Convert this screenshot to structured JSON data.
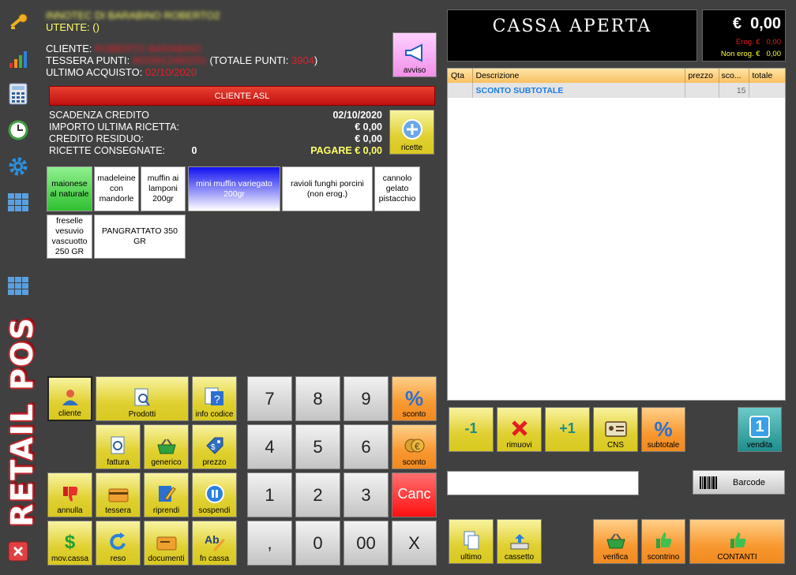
{
  "header": {
    "store_name": "INNOTEC DI BARABINO ROBERTO2",
    "user_label": "UTENTE:",
    "user_value": "()",
    "client_label": "CLIENTE:",
    "client_value": "ROBERTO BARABINO",
    "card_label": "TESSERA PUNTI:",
    "card_value": "8033912483291",
    "total_points_label": "(TOTALE PUNTI:",
    "total_points_value": "3904",
    "total_points_close": ")",
    "last_purchase_label": "ULTIMO ACQUISTO:",
    "last_purchase_value": "02/10/2020"
  },
  "avviso_label": "avviso",
  "asl_banner": "CLIENTE ASL",
  "credit": {
    "expiry_label": "SCADENZA CREDITO",
    "expiry_value": "02/10/2020",
    "last_recipe_label": "IMPORTO ULTIMA RICETTA:",
    "last_recipe_value": "€ 0,00",
    "residual_label": "CREDITO RESIDUO:",
    "residual_value": "€ 0,00",
    "recipes_label": "RICETTE CONSEGNATE:",
    "recipes_value": "0",
    "pay_label": "PAGARE € 0,00"
  },
  "ricette_label": "ricette",
  "products": [
    "maionese al naturale",
    "madeleine con mandorle",
    "muffin ai lamponi 200gr",
    "mini muffin variegato 200gr",
    "ravioli funghi porcini (non erog.)",
    "cannolo gelato pistacchio",
    "freselle vesuvio vascuotto 250 GR",
    "PANGRATTATO 350 GR"
  ],
  "status": {
    "title": "CASSA APERTA",
    "currency": "€",
    "total": "0,00",
    "erog_label": "Erog. €",
    "erog_value": "0,00",
    "nonerog_label": "Non erog. €",
    "nonerog_value": "0,00"
  },
  "table": {
    "headers": [
      "Qta",
      "Descrizione",
      "prezzo",
      "sco...",
      "totale"
    ],
    "rows": [
      {
        "qta": "",
        "descr": "SCONTO SUBTOTALE",
        "prezzo": "",
        "sconto": "15",
        "totale": ""
      }
    ]
  },
  "buttons": {
    "cliente": "cliente",
    "prodotti": "Prodotti",
    "info_codice": "info codice",
    "fattura": "fattura",
    "generico": "generico",
    "prezzo": "prezzo",
    "annulla": "annulla",
    "tessera": "tessera",
    "riprendi": "riprendi",
    "sospendi": "sospendi",
    "mov_cassa": "mov.cassa",
    "reso": "reso",
    "documenti": "documenti",
    "fn_cassa": "fn cassa",
    "sconto1": "sconto",
    "sconto2": "sconto",
    "canc": "Canc",
    "minus1": "-1",
    "rimuovi": "rimuovi",
    "plus1": "+1",
    "cns": "CNS",
    "subtotale": "subtotale",
    "vendita": "vendita",
    "vendita_num": "1",
    "barcode": "Barcode",
    "ultimo": "ultimo",
    "cassetto": "cassetto",
    "verifica": "verifica",
    "scontrino": "scontrino",
    "contanti": "CONTANTI"
  },
  "numpad": [
    "7",
    "8",
    "9",
    "4",
    "5",
    "6",
    "1",
    "2",
    "3",
    ",",
    "0",
    "00",
    "X"
  ],
  "brand": "RETAIL POS",
  "barcode_input_value": ""
}
